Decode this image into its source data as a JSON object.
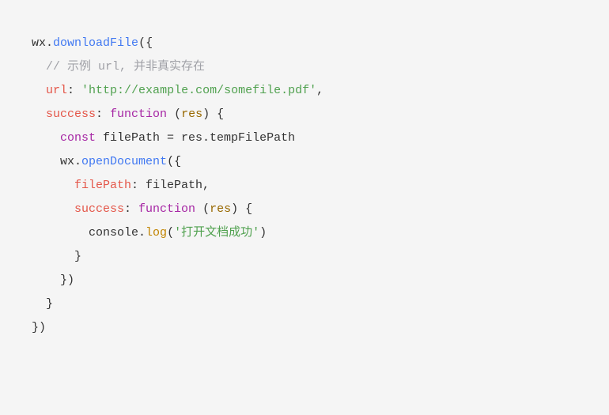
{
  "code": {
    "l1": {
      "wx": "wx",
      "dot1": ".",
      "downloadFile": "downloadFile",
      "rest": "({"
    },
    "l2": {
      "comment": "// 示例 url, 并非真实存在"
    },
    "l3": {
      "key": "url",
      "colon": ": ",
      "str": "'http://example.com/somefile.pdf'",
      "comma": ","
    },
    "l4": {
      "key": "success",
      "colon": ": ",
      "fn": "function",
      "sp": " (",
      "param": "res",
      "rest": ") {"
    },
    "l5": {
      "const": "const",
      "sp1": " filePath = res.tempFilePath"
    },
    "l6": {
      "wx": "wx",
      "dot": ".",
      "open": "openDocument",
      "rest": "({"
    },
    "l7": {
      "key": "filePath",
      "rest": ": filePath,"
    },
    "l8": {
      "key": "success",
      "colon": ": ",
      "fn": "function",
      "sp": " (",
      "param": "res",
      "rest": ") {"
    },
    "l9": {
      "console": "console",
      "dot": ".",
      "log": "log",
      "open": "(",
      "str": "'打开文档成功'",
      "close": ")"
    },
    "l10": {
      "brace": "}"
    },
    "l11": {
      "brace": "})"
    },
    "l12": {
      "brace": "}"
    },
    "l13": {
      "brace": "})"
    }
  }
}
